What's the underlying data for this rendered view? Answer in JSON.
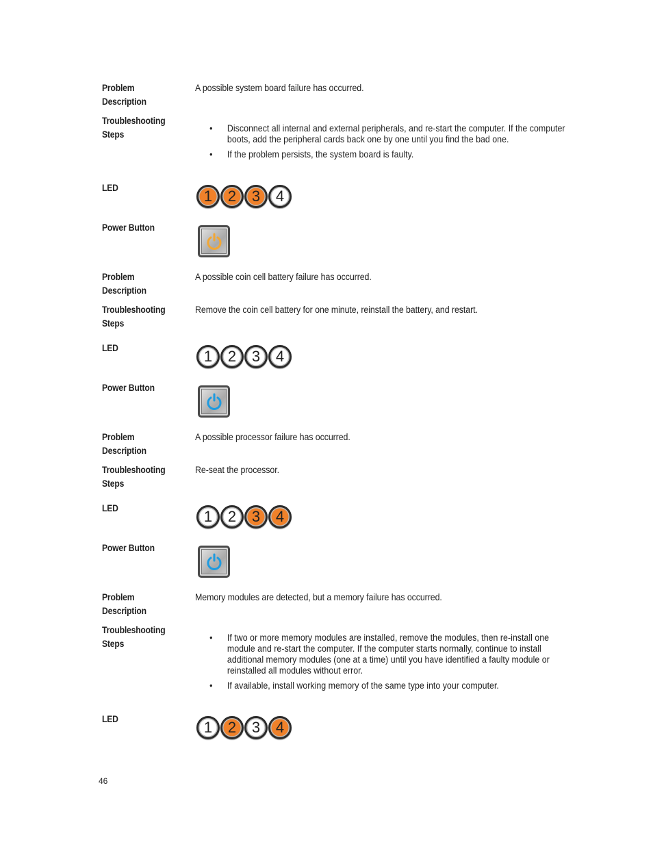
{
  "labels": {
    "problem": "Problem Description",
    "problem_l1": "Problem",
    "problem_l2": "Description",
    "steps_l1": "Troubleshooting",
    "steps_l2": "Steps",
    "led": "LED",
    "power": "Power Button"
  },
  "sections": [
    {
      "problem": "A possible system board failure has occurred.",
      "steps": [
        "Disconnect all internal and external peripherals, and re-start the computer. If the computer boots, add the peripheral cards back one by one until you find the bad one.",
        "If the problem persists, the system board is faulty."
      ],
      "leds": [
        {
          "n": "1",
          "on": true
        },
        {
          "n": "2",
          "on": true
        },
        {
          "n": "3",
          "on": true
        },
        {
          "n": "4",
          "on": false
        }
      ],
      "power_color": "amber"
    },
    {
      "problem": "A possible coin cell battery failure has occurred.",
      "steps_text": "Remove the coin cell battery for one minute, reinstall the battery, and restart.",
      "leds": [
        {
          "n": "1",
          "on": false
        },
        {
          "n": "2",
          "on": false
        },
        {
          "n": "3",
          "on": false
        },
        {
          "n": "4",
          "on": false
        }
      ],
      "power_color": "blue"
    },
    {
      "problem": "A possible processor failure has occurred.",
      "steps_text": "Re-seat the processor.",
      "leds": [
        {
          "n": "1",
          "on": false
        },
        {
          "n": "2",
          "on": false
        },
        {
          "n": "3",
          "on": true
        },
        {
          "n": "4",
          "on": true
        }
      ],
      "power_color": "blue"
    },
    {
      "problem": "Memory modules are detected, but a memory failure has occurred.",
      "steps": [
        "If two or more memory modules are installed, remove the modules, then re-install one module and re-start the computer. If the computer starts normally, continue to install additional memory modules (one at a time) until you have identified a faulty module or reinstalled all modules without error.",
        "If available, install working memory of the same type into your computer."
      ],
      "leds": [
        {
          "n": "1",
          "on": false
        },
        {
          "n": "2",
          "on": true
        },
        {
          "n": "3",
          "on": false
        },
        {
          "n": "4",
          "on": true
        }
      ]
    }
  ],
  "colors": {
    "led_on": "#f0812a",
    "power_amber": "#f2a735",
    "power_blue": "#1e9be0"
  },
  "page_number": "46"
}
